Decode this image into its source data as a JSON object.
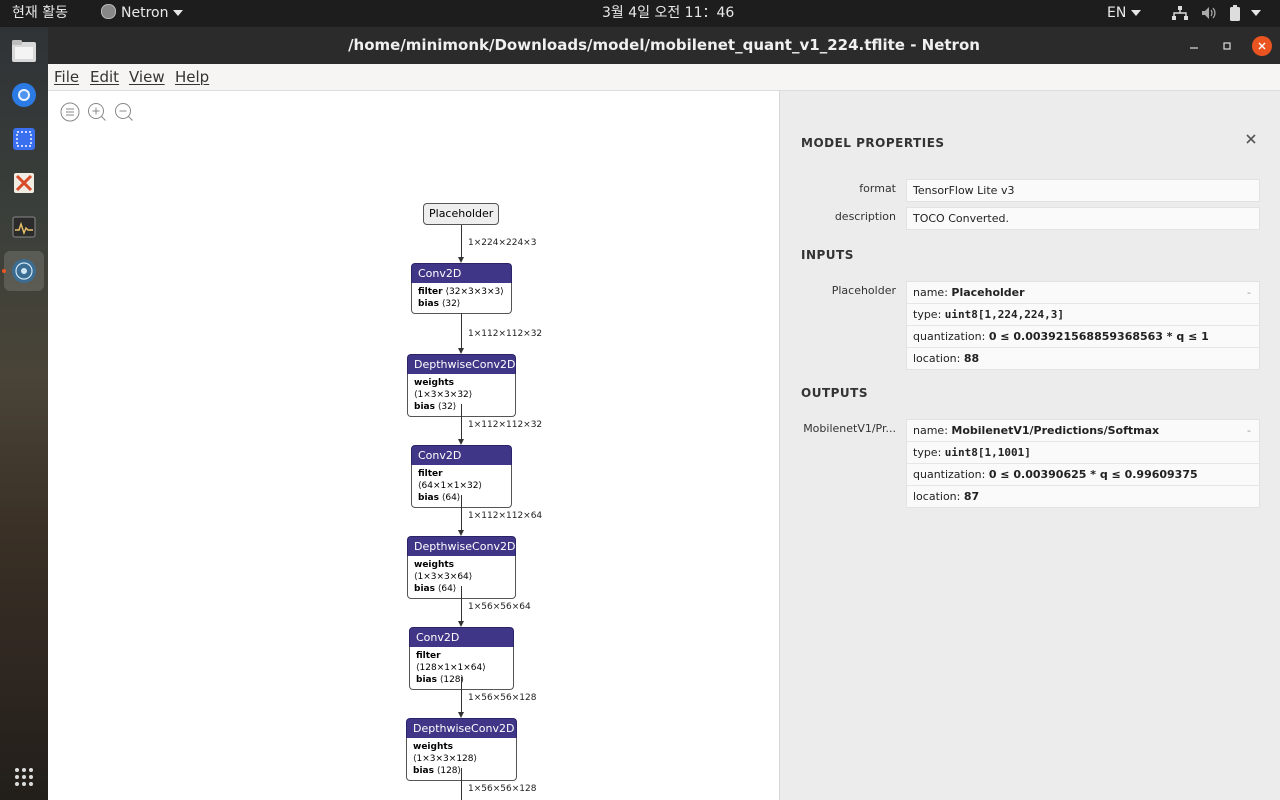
{
  "topbar": {
    "activities": "현재 활동",
    "app_name": "Netron",
    "clock": "3월 4일  오전 11：46",
    "lang": "EN"
  },
  "dock": {
    "items": [
      "files-icon",
      "chromium-icon",
      "screenshot-icon",
      "xarchiver-icon",
      "system-monitor-icon",
      "netron-icon"
    ],
    "active": "netron-icon",
    "apps_grid": "show-apps-icon"
  },
  "window": {
    "title": "/home/minimonk/Downloads/model/mobilenet_quant_v1_224.tflite - Netron",
    "menu": [
      "File",
      "Edit",
      "View",
      "Help"
    ]
  },
  "graph": {
    "input_node": "Placeholder",
    "edges": [
      "1×224×224×3",
      "1×112×112×32",
      "1×112×112×32",
      "1×112×112×64",
      "1×56×56×64",
      "1×56×56×128",
      "1×56×56×128"
    ],
    "nodes": [
      {
        "op": "Conv2D",
        "a_key": "filter",
        "a_val": "⟨32×3×3×3⟩",
        "b_key": "bias",
        "b_val": "⟨32⟩"
      },
      {
        "op": "DepthwiseConv2D",
        "a_key": "weights",
        "a_val": "⟨1×3×3×32⟩",
        "b_key": "bias",
        "b_val": "⟨32⟩"
      },
      {
        "op": "Conv2D",
        "a_key": "filter",
        "a_val": "⟨64×1×1×32⟩",
        "b_key": "bias",
        "b_val": "⟨64⟩"
      },
      {
        "op": "DepthwiseConv2D",
        "a_key": "weights",
        "a_val": "⟨1×3×3×64⟩",
        "b_key": "bias",
        "b_val": "⟨64⟩"
      },
      {
        "op": "Conv2D",
        "a_key": "filter",
        "a_val": "⟨128×1×1×64⟩",
        "b_key": "bias",
        "b_val": "⟨128⟩"
      },
      {
        "op": "DepthwiseConv2D",
        "a_key": "weights",
        "a_val": "⟨1×3×3×128⟩",
        "b_key": "bias",
        "b_val": "⟨128⟩"
      }
    ]
  },
  "properties": {
    "title": "MODEL PROPERTIES",
    "format_label": "format",
    "format_value": "TensorFlow Lite v3",
    "description_label": "description",
    "description_value": "TOCO Converted.",
    "inputs_title": "INPUTS",
    "input": {
      "label": "Placeholder",
      "name_key": "name: ",
      "name": "Placeholder",
      "type_key": "type: ",
      "type": "uint8[1,224,224,3]",
      "quant_key": "quantization: ",
      "quantization": "0 ≤ 0.003921568859368563 * q ≤ 1",
      "loc_key": "location: ",
      "location": "88"
    },
    "outputs_title": "OUTPUTS",
    "output": {
      "label": "MobilenetV1/Pr...",
      "name_key": "name: ",
      "name": "MobilenetV1/Predictions/Softmax",
      "type_key": "type: ",
      "type": "uint8[1,1001]",
      "quant_key": "quantization: ",
      "quantization": "0 ≤ 0.00390625 * q ≤ 0.99609375",
      "loc_key": "location: ",
      "location": "87"
    },
    "dash": "-"
  }
}
